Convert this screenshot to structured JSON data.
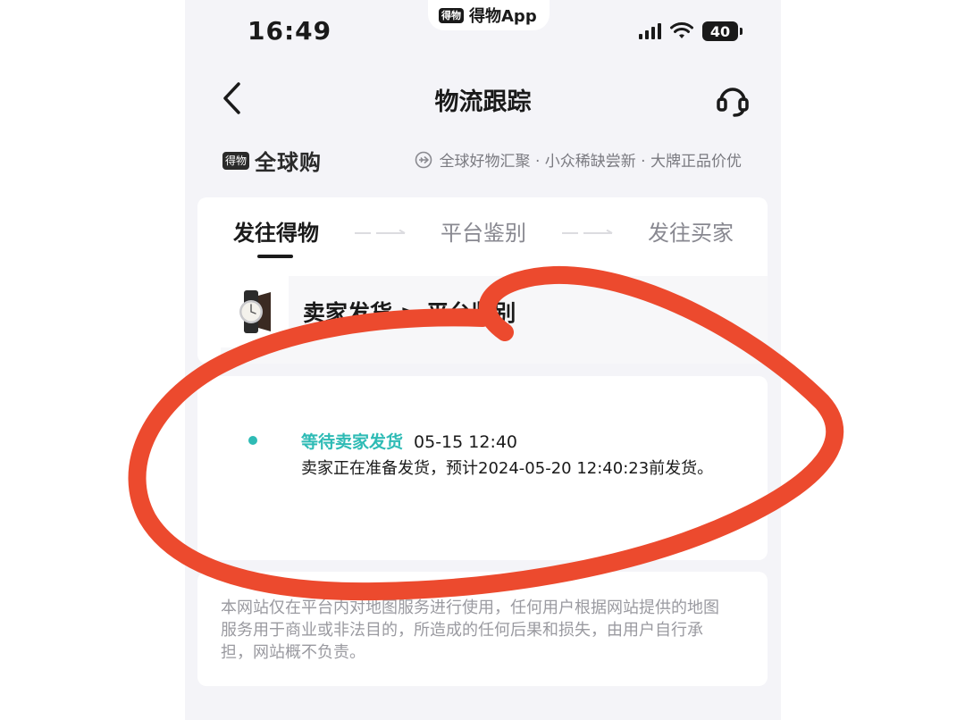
{
  "status_bar": {
    "time": "16:49",
    "app_badge": "得物",
    "app_name": "得物App",
    "battery": "40"
  },
  "nav": {
    "title": "物流跟踪",
    "back_icon": "chevron-left-icon",
    "service_icon": "headset-icon"
  },
  "banner": {
    "brand_badge": "得物",
    "brand_name": "全球购",
    "slogan": "全球好物汇聚 · 小众稀缺尝新 · 大牌正品价优"
  },
  "steps": [
    {
      "label": "发往得物",
      "active": true
    },
    {
      "label": "平台鉴别",
      "active": false
    },
    {
      "label": "发往买家",
      "active": false
    }
  ],
  "product": {
    "route": "卖家发货 > 平台鉴别",
    "thumb_icon": "watch-icon"
  },
  "timeline": [
    {
      "status": "等待卖家发货",
      "time": "05-15 12:40",
      "description": "卖家正在准备发货，预计2024-05-20 12:40:23前发货。"
    }
  ],
  "disclaimer": "本网站仅在平台内对地图服务进行使用，任何用户根据网站提供的地图服务用于商业或非法目的，所造成的任何后果和损失，由用户自行承担，网站概不负责。",
  "colors": {
    "accent_teal": "#2ebbb5",
    "annotation_red": "#ec4a2e",
    "page_bg": "#f4f4f8"
  }
}
